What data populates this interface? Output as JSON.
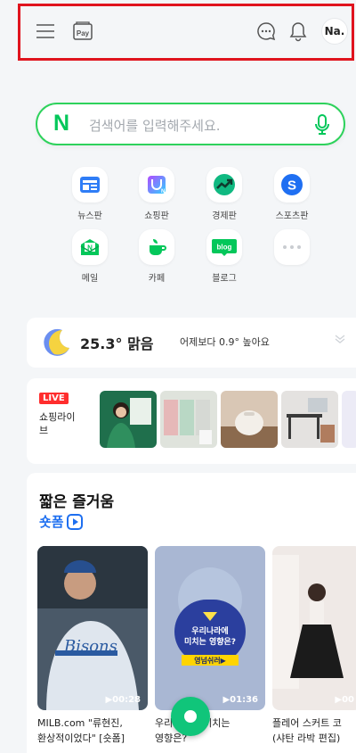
{
  "header": {
    "icons": [
      "menu-icon",
      "pay-icon",
      "chat-icon",
      "bell-icon"
    ],
    "pay_label": "Pay",
    "avatar": "Na."
  },
  "search": {
    "logo": "N",
    "placeholder": "검색어를 입력해주세요."
  },
  "shortcuts": [
    {
      "label": "뉴스판",
      "icon": "news-icon"
    },
    {
      "label": "쇼핑판",
      "icon": "shopping-icon"
    },
    {
      "label": "경제판",
      "icon": "economy-icon"
    },
    {
      "label": "스포츠판",
      "icon": "sports-icon"
    },
    {
      "label": "메일",
      "icon": "mail-icon"
    },
    {
      "label": "카페",
      "icon": "cafe-icon"
    },
    {
      "label": "블로그",
      "icon": "blog-icon"
    },
    {
      "label": "",
      "icon": "more-icon"
    }
  ],
  "weather": {
    "temp": "25.3°",
    "condition": "맑음",
    "compare": "어제보다 0.9° 높아요"
  },
  "live": {
    "badge": "LIVE",
    "label": "쇼핑라이브"
  },
  "shorts": {
    "title": "짧은 즐거움",
    "brand": "숏폼",
    "videos": [
      {
        "duration": "▶00:28",
        "caption1": "MILB.com \"류현진,",
        "caption2": "환상적이었다\" [숏폼]"
      },
      {
        "duration": "▶01:36",
        "caption1": "우리나라에 미치는",
        "caption2": "영향은?",
        "overlay1": "우리나라에",
        "overlay2": "미치는 영향은?",
        "tag": "영넘쉬러▶"
      },
      {
        "duration": "▶00",
        "caption1": "플레어 스커트 코",
        "caption2": "(샤탄 라박 편집)"
      }
    ]
  }
}
